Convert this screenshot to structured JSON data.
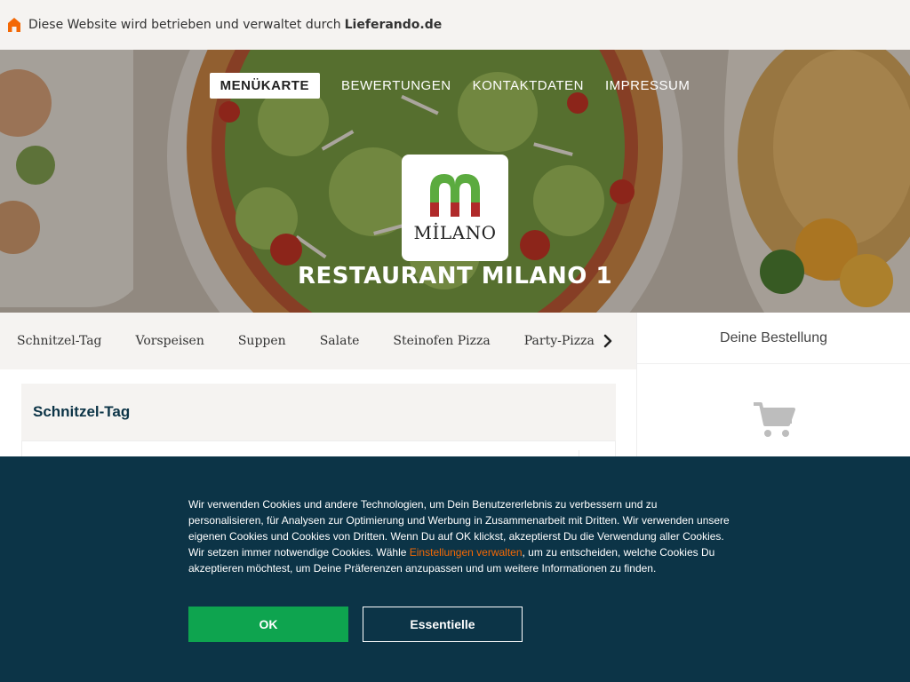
{
  "topbar": {
    "text": "Diese Website wird betrieben und verwaltet durch",
    "brand": "Lieferando.de",
    "icon": "house-icon",
    "icon_color": "#f36805"
  },
  "nav": {
    "items": [
      {
        "label": "MENÜKARTE",
        "active": true
      },
      {
        "label": "BEWERTUNGEN",
        "active": false
      },
      {
        "label": "KONTAKTDATEN",
        "active": false
      },
      {
        "label": "IMPRESSUM",
        "active": false
      }
    ]
  },
  "hero": {
    "logo_text": "MİLANO",
    "restaurant_name": "RESTAURANT MILANO 1"
  },
  "categories": {
    "items": [
      "Schnitzel-Tag",
      "Vorspeisen",
      "Suppen",
      "Salate",
      "Steinofen Pizza",
      "Party-Pizza"
    ],
    "next_icon": "chevron-right-icon"
  },
  "basket": {
    "title": "Deine Bestellung",
    "icon": "shopping-cart-icon"
  },
  "menu": {
    "section_title": "Schnitzel-Tag"
  },
  "cookie": {
    "text_before": "Wir verwenden Cookies und andere Technologien, um Dein Benutzererlebnis zu verbessern und zu personalisieren, für Analysen zur Optimierung und Werbung in Zusammenarbeit mit Dritten. Wir verwenden unsere eigenen Cookies und Cookies von Dritten. Wenn Du auf OK klickst, akzeptierst Du die Verwendung aller Cookies. Wir setzen immer notwendige Cookies. Wähle ",
    "link_text": "Einstellungen verwalten",
    "text_after": ", um zu entscheiden, welche Cookies Du akzeptieren möchtest, um Deine Präferenzen anzupassen und um weitere Informationen zu finden.",
    "ok_label": "OK",
    "essential_label": "Essentielle"
  },
  "colors": {
    "accent": "#f36805",
    "banner_bg": "#0c3447",
    "ok_green": "#0ea44f",
    "logo_green": "#5bab3f",
    "logo_red": "#b02a2a"
  }
}
